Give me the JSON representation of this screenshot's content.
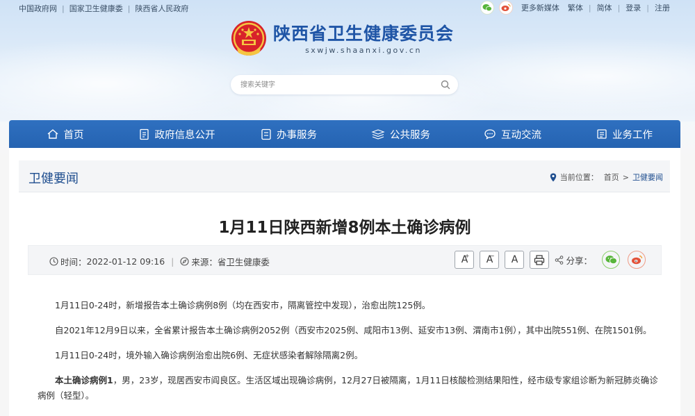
{
  "topbar": {
    "links": [
      "中国政府网",
      "国家卫生健康委",
      "陕西省人民政府"
    ],
    "right_links": [
      "更多新媒体",
      "繁体",
      "简体",
      "登录",
      "注册"
    ]
  },
  "logo": {
    "title": "陕西省卫生健康委员会",
    "domain": "sxwjw.shaanxi.gov.cn"
  },
  "search": {
    "placeholder": "搜索关键字"
  },
  "nav": {
    "items": [
      {
        "label": "首页",
        "icon": "home-icon"
      },
      {
        "label": "政府信息公开",
        "icon": "document-icon"
      },
      {
        "label": "办事服务",
        "icon": "list-icon"
      },
      {
        "label": "公共服务",
        "icon": "stack-icon"
      },
      {
        "label": "互动交流",
        "icon": "chat-icon"
      },
      {
        "label": "业务工作",
        "icon": "briefcase-icon"
      }
    ]
  },
  "breadcrumb": {
    "section_title": "卫健要闻",
    "location_label": "当前位置：",
    "home": "首页",
    "separator": ">",
    "current": "卫健要闻"
  },
  "article": {
    "title": "1月11日陕西新增8例本土确诊病例",
    "time_label": "时间：",
    "time": "2022-01-12 09:16",
    "source_label": "来源：",
    "source": "省卫生健康委",
    "font_buttons": [
      "A",
      "A",
      "A"
    ],
    "share_label": "分享：",
    "paragraphs": [
      "1月11日0-24时，新增报告本土确诊病例8例（均在西安市，隔离管控中发现），治愈出院125例。",
      "自2021年12月9日以来，全省累计报告本土确诊病例2052例（西安市2025例、咸阳市13例、延安市13例、渭南市1例），其中出院551例、在院1501例。",
      "1月11日0-24时，境外输入确诊病例治愈出院6例、无症状感染者解除隔离2例。"
    ],
    "case_bold": "本土确诊病例1",
    "case_text": "，男，23岁，现居西安市阎良区。生活区域出现确诊病例，12月27日被隔离，1月11日核酸检测结果阳性，经市级专家组诊断为新冠肺炎确诊病例（轻型）。"
  },
  "colors": {
    "nav_bg": "#2563b1",
    "brand_blue": "#1f55a6",
    "wechat_green": "#57b53a",
    "weibo_red": "#e2523a"
  }
}
